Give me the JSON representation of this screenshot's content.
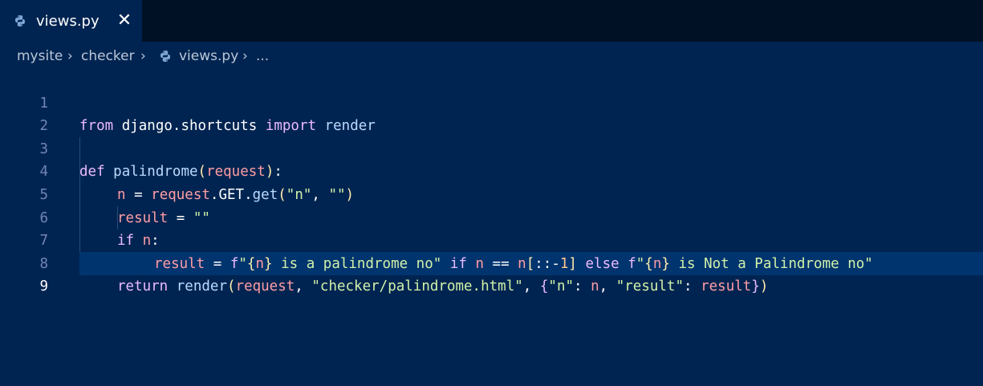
{
  "tab": {
    "label": "views.py",
    "close_glyph": "✕",
    "icon": "python-icon"
  },
  "breadcrumb": {
    "items": [
      "mysite",
      "checker",
      "views.py",
      "..."
    ],
    "separator": "›"
  },
  "editor": {
    "line_numbers": [
      "1",
      "2",
      "3",
      "4",
      "5",
      "6",
      "7",
      "8",
      "9"
    ],
    "active_line": "9",
    "lines": {
      "l1": {
        "t1": "from",
        "t2": " ",
        "t3": "django.shortcuts",
        "t4": " ",
        "t5": "import",
        "t6": " ",
        "t7": "render"
      },
      "l3": {
        "t1": "def",
        "t2": " ",
        "t3": "palindrome",
        "t4": "(",
        "t5": "request",
        "t6": ")",
        "t7": ":"
      },
      "l4": {
        "t1": "n",
        "t2": " = ",
        "t3": "request",
        "t4": ".",
        "t5": "GET",
        "t6": ".",
        "t7": "get",
        "t8": "(",
        "t9": "\"n\"",
        "t10": ", ",
        "t11": "\"\"",
        "t12": ")"
      },
      "l5": {
        "t1": "result",
        "t2": " = ",
        "t3": "\"\""
      },
      "l6": {
        "t1": "if",
        "t2": " ",
        "t3": "n",
        "t4": ":"
      },
      "l7": {
        "t1": "result",
        "t2": " = ",
        "t3": "f",
        "t4": "\"",
        "t5": "{",
        "t6": "n",
        "t7": "}",
        "t8": " is a palindrome no\"",
        "t9": " ",
        "t10": "if",
        "t11": " ",
        "t12": "n",
        "t13": " == ",
        "t14": "n",
        "t15": "[",
        "t16": "::-",
        "t17": "1",
        "t18": "]",
        "t19": " ",
        "t20": "else",
        "t21": " ",
        "t22": "f",
        "t23": "\"",
        "t24": "{",
        "t25": "n",
        "t26": "}",
        "t27": " is Not a Palindrome no\""
      },
      "l8": {
        "t1": "return",
        "t2": " ",
        "t3": "render",
        "t4": "(",
        "t5": "request",
        "t6": ", ",
        "t7": "\"checker/palindrome.html\"",
        "t8": ", ",
        "t9": "{",
        "t10": "\"n\"",
        "t11": ": ",
        "t12": "n",
        "t13": ", ",
        "t14": "\"result\"",
        "t15": ": ",
        "t16": "result",
        "t17": "}",
        "t18": ")"
      }
    }
  },
  "colors": {
    "background": "#002451",
    "tabbar": "#001126",
    "keyword": "#ebbbff",
    "function": "#bbdaff",
    "string": "#d1f1a9",
    "variable": "#ff9da4",
    "number": "#ffc58f",
    "line_number": "#7285b7"
  }
}
